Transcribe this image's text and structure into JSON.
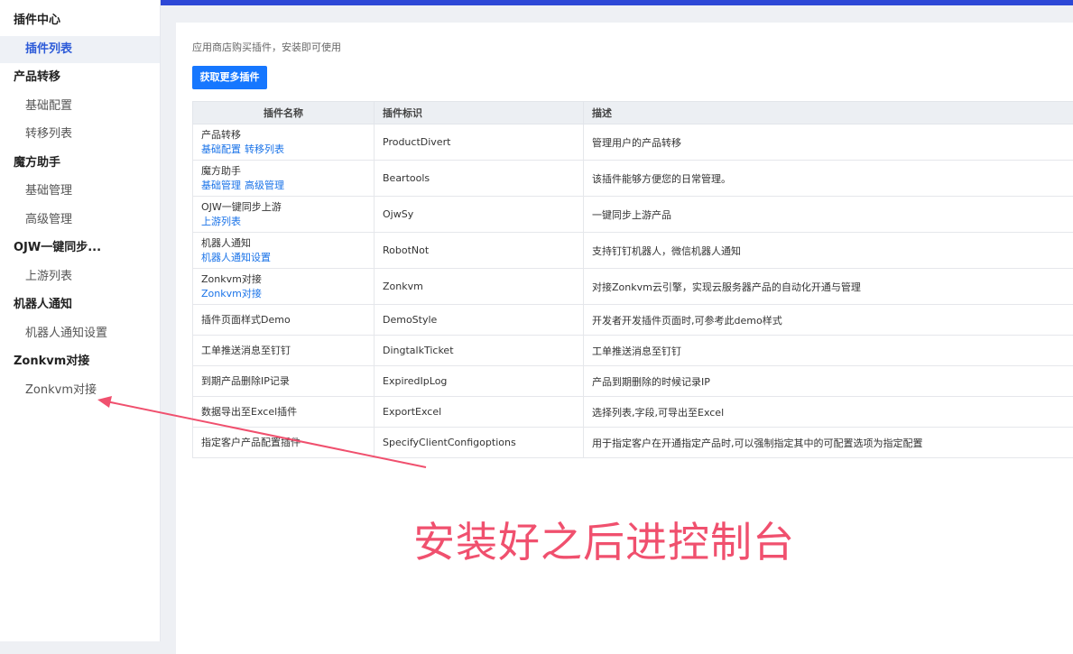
{
  "sidebar": {
    "groups": [
      {
        "label": "插件中心",
        "items": [
          {
            "label": "插件列表",
            "active": true
          }
        ]
      },
      {
        "label": "产品转移",
        "items": [
          {
            "label": "基础配置"
          },
          {
            "label": "转移列表"
          }
        ]
      },
      {
        "label": "魔方助手",
        "items": [
          {
            "label": "基础管理"
          },
          {
            "label": "高级管理"
          }
        ]
      },
      {
        "label": "OJW一键同步...",
        "items": [
          {
            "label": "上游列表"
          }
        ]
      },
      {
        "label": "机器人通知",
        "items": [
          {
            "label": "机器人通知设置"
          }
        ]
      },
      {
        "label": "Zonkvm对接",
        "items": [
          {
            "label": "Zonkvm对接"
          }
        ]
      }
    ]
  },
  "main": {
    "description": "应用商店购买插件，安装即可使用",
    "get_more_button": "获取更多插件",
    "table": {
      "headers": [
        "插件名称",
        "插件标识",
        "描述"
      ],
      "rows": [
        {
          "name": "产品转移",
          "links": [
            "基础配置",
            "转移列表"
          ],
          "id": "ProductDivert",
          "desc": "管理用户的产品转移"
        },
        {
          "name": "魔方助手",
          "links": [
            "基础管理",
            "高级管理"
          ],
          "id": "Beartools",
          "desc": "该插件能够方便您的日常管理。"
        },
        {
          "name": "OJW一键同步上游",
          "links": [
            "上游列表"
          ],
          "id": "OjwSy",
          "desc": "一键同步上游产品"
        },
        {
          "name": "机器人通知",
          "links": [
            "机器人通知设置"
          ],
          "id": "RobotNot",
          "desc": "支持钉钉机器人，微信机器人通知"
        },
        {
          "name": "Zonkvm对接",
          "links": [
            "Zonkvm对接"
          ],
          "id": "Zonkvm",
          "desc": "对接Zonkvm云引擎，实现云服务器产品的自动化开通与管理"
        },
        {
          "name": "插件页面样式Demo",
          "links": [],
          "id": "DemoStyle",
          "desc": "开发者开发插件页面时,可参考此demo样式"
        },
        {
          "name": "工单推送消息至钉钉",
          "links": [],
          "id": "DingtalkTicket",
          "desc": "工单推送消息至钉钉"
        },
        {
          "name": "到期产品删除IP记录",
          "links": [],
          "id": "ExpiredIpLog",
          "desc": "产品到期删除的时候记录IP"
        },
        {
          "name": "数据导出至Excel插件",
          "links": [],
          "id": "ExportExcel",
          "desc": "选择列表,字段,可导出至Excel"
        },
        {
          "name": "指定客户产品配置插件",
          "links": [],
          "id": "SpecifyClientConfigoptions",
          "desc": "用于指定客户在开通指定产品时,可以强制指定其中的可配置选项为指定配置"
        }
      ]
    }
  },
  "annotation": {
    "text": "安装好之后进控制台",
    "color": "#f0506e"
  },
  "colors": {
    "accent": "#1677ff",
    "link": "#1a73e8",
    "topbar": "#2d48d6"
  }
}
